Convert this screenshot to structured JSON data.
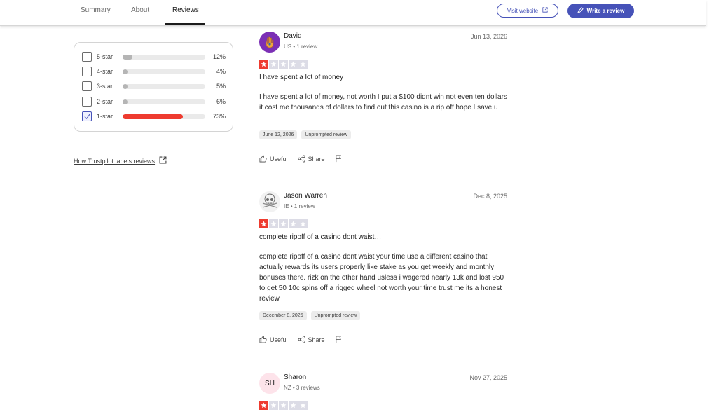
{
  "header": {
    "tabs": [
      {
        "label": "Summary"
      },
      {
        "label": "About"
      },
      {
        "label": "Reviews"
      }
    ],
    "visit_label": "Visit website",
    "write_label": "Write a review",
    "accent": "#4652b8"
  },
  "filter": {
    "rows": [
      {
        "label": "5-star",
        "pct_text": "12%",
        "pct": 12,
        "checked": false
      },
      {
        "label": "4-star",
        "pct_text": "4%",
        "pct": 4,
        "checked": false
      },
      {
        "label": "3-star",
        "pct_text": "5%",
        "pct": 5,
        "checked": false
      },
      {
        "label": "2-star",
        "pct_text": "6%",
        "pct": 6,
        "checked": false
      },
      {
        "label": "1-star",
        "pct_text": "73%",
        "pct": 73,
        "checked": true
      }
    ],
    "labels_link": "How Trustpilot labels reviews",
    "fill_color_selected": "#ee3b2f"
  },
  "reviews": [
    {
      "name": "David",
      "meta": "US • 1 review",
      "date": "Jun 13, 2026",
      "stars": 1,
      "title": "I have spent a lot of money",
      "body": "I have spent a lot of money, not worth I put a $100 didnt win not even ten dollars it cost me thousands of dollars to find out this casino is a rip off hope I save u",
      "chips": [
        "June 12, 2026",
        "Unprompted review"
      ],
      "actions": {
        "useful": "Useful",
        "share": "Share"
      },
      "avatar": "hamsa-icon"
    },
    {
      "name": "Jason Warren",
      "meta": "IE • 1 review",
      "date": "Dec 8, 2025",
      "stars": 1,
      "title": "complete ripoff of a casino dont waist…",
      "body": "complete ripoff of a casino dont waist your time use a different casino that actually rewards its users properly like stake as you get weekly and monthly bonuses there. rizk on the other hand usless i wagered nearly 13k and lost 950 to get 50 10c spins off a rigged wheel not worth your time trust me its a honest review",
      "chips": [
        "December 8, 2025",
        "Unprompted review"
      ],
      "actions": {
        "useful": "Useful",
        "share": "Share"
      },
      "avatar": "skull-icon"
    },
    {
      "name": "Sharon",
      "meta": "NZ • 3 reviews",
      "date": "Nov 27, 2025",
      "stars": 1,
      "initials": "SH",
      "avatar": "initials"
    }
  ]
}
